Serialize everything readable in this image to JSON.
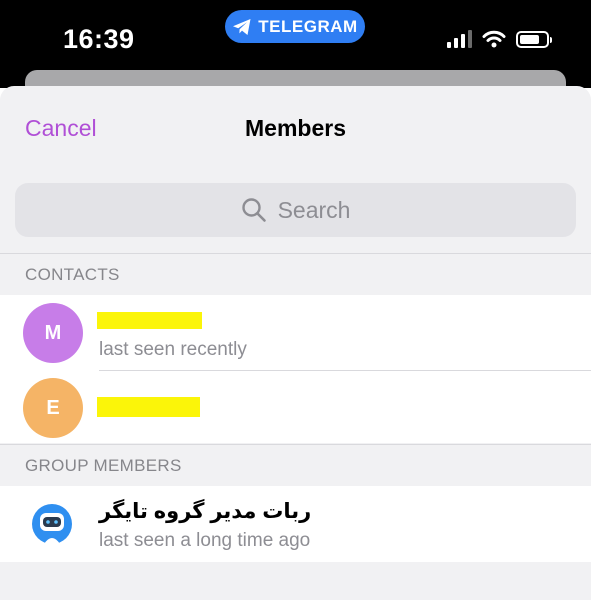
{
  "status_bar": {
    "time": "16:39",
    "app_pill_label": "TELEGRAM",
    "icons": [
      "signal-icon",
      "wifi-icon",
      "battery-icon"
    ]
  },
  "nav": {
    "cancel_label": "Cancel",
    "title": "Members"
  },
  "search": {
    "placeholder": "Search"
  },
  "sections": {
    "contacts_label": "CONTACTS",
    "group_members_label": "GROUP MEMBERS"
  },
  "contacts": [
    {
      "initial": "M",
      "status": "last seen recently"
    },
    {
      "initial": "E"
    }
  ],
  "members": [
    {
      "name": "ربات مدیر گروه تایگر",
      "status": "last seen a long time ago"
    }
  ],
  "colors": {
    "accent": "#b04fd6",
    "telegram_blue": "#2f7ef3",
    "avatar_m": "#c77de8",
    "avatar_e": "#f5b466",
    "redaction": "#fbf509"
  }
}
